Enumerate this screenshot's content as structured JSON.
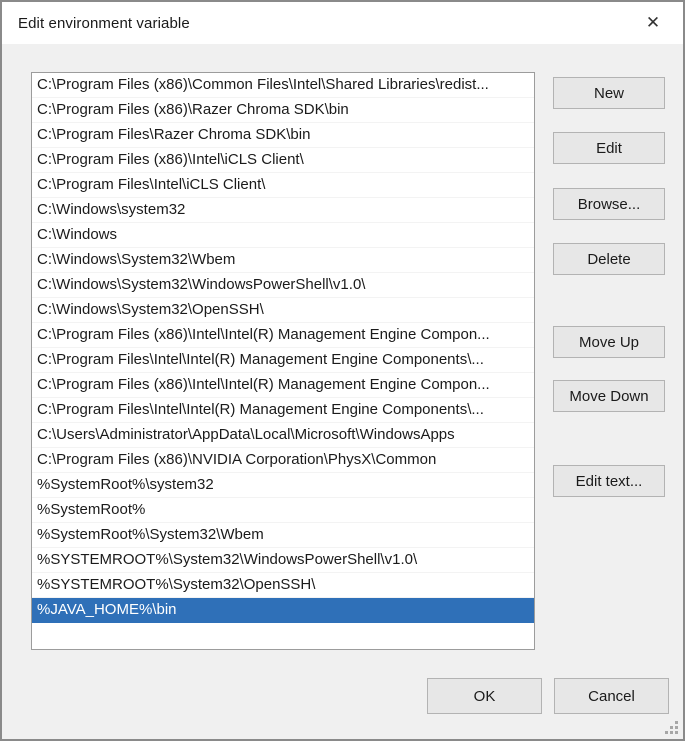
{
  "dialog": {
    "title": "Edit environment variable",
    "close_glyph": "✕"
  },
  "list": {
    "selected_index": 21,
    "items": [
      "C:\\Program Files (x86)\\Common Files\\Intel\\Shared Libraries\\redist...",
      "C:\\Program Files (x86)\\Razer Chroma SDK\\bin",
      "C:\\Program Files\\Razer Chroma SDK\\bin",
      "C:\\Program Files (x86)\\Intel\\iCLS Client\\",
      "C:\\Program Files\\Intel\\iCLS Client\\",
      "C:\\Windows\\system32",
      "C:\\Windows",
      "C:\\Windows\\System32\\Wbem",
      "C:\\Windows\\System32\\WindowsPowerShell\\v1.0\\",
      "C:\\Windows\\System32\\OpenSSH\\",
      "C:\\Program Files (x86)\\Intel\\Intel(R) Management Engine Compon...",
      "C:\\Program Files\\Intel\\Intel(R) Management Engine Components\\...",
      "C:\\Program Files (x86)\\Intel\\Intel(R) Management Engine Compon...",
      "C:\\Program Files\\Intel\\Intel(R) Management Engine Components\\...",
      "C:\\Users\\Administrator\\AppData\\Local\\Microsoft\\WindowsApps",
      "C:\\Program Files (x86)\\NVIDIA Corporation\\PhysX\\Common",
      "%SystemRoot%\\system32",
      "%SystemRoot%",
      "%SystemRoot%\\System32\\Wbem",
      "%SYSTEMROOT%\\System32\\WindowsPowerShell\\v1.0\\",
      "%SYSTEMROOT%\\System32\\OpenSSH\\",
      "%JAVA_HOME%\\bin"
    ]
  },
  "buttons": {
    "new": "New",
    "edit": "Edit",
    "browse": "Browse...",
    "delete": "Delete",
    "move_up": "Move Up",
    "move_down": "Move Down",
    "edit_text": "Edit text...",
    "ok": "OK",
    "cancel": "Cancel"
  },
  "colors": {
    "selection_background": "#2F70B8",
    "selection_text": "#FFFFFF"
  }
}
